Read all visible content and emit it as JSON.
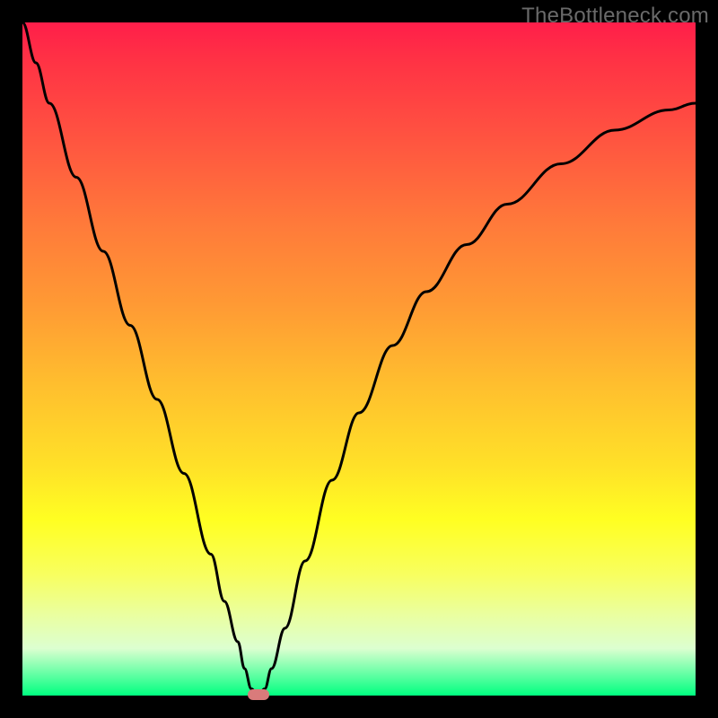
{
  "watermark": "TheBottleneck.com",
  "chart_data": {
    "type": "line",
    "title": "",
    "xlabel": "",
    "ylabel": "",
    "xlim": [
      0,
      100
    ],
    "ylim": [
      0,
      100
    ],
    "grid": false,
    "legend": false,
    "x": [
      0,
      2,
      4,
      8,
      12,
      16,
      20,
      24,
      28,
      30,
      32,
      33,
      34,
      35,
      36,
      37,
      39,
      42,
      46,
      50,
      55,
      60,
      66,
      72,
      80,
      88,
      96,
      100
    ],
    "y": [
      100,
      94,
      88,
      77,
      66,
      55,
      44,
      33,
      21,
      14,
      8,
      4,
      1,
      0,
      1,
      4,
      10,
      20,
      32,
      42,
      52,
      60,
      67,
      73,
      79,
      84,
      87,
      88
    ],
    "curve_color": "#000000",
    "curve_width": 2,
    "marker": {
      "x": 35,
      "y": 0,
      "color": "#d97b7b"
    },
    "background_gradient": {
      "top": "#ff1e4a",
      "mid": "#ffff22",
      "bottom": "#00ff80"
    }
  }
}
